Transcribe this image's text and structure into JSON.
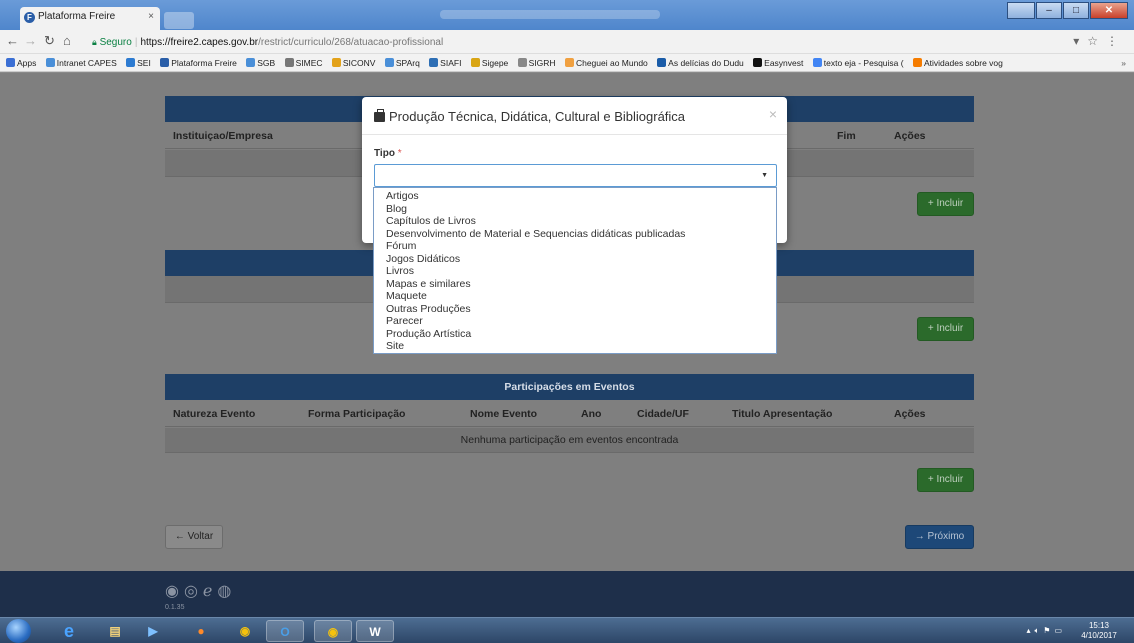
{
  "browser": {
    "tab_title": "Plataforma Freire",
    "tab_close": "×",
    "url_secure_label": "Seguro",
    "url_host": "https://freire2.capes.gov.br",
    "url_path": "/restrict/curriculo/268/atuacao-profissional",
    "bookmarks": [
      "Apps",
      "Intranet CAPES",
      "SEI",
      "Plataforma Freire",
      "SGB",
      "SIMEC",
      "SICONV",
      "SPArq",
      "SIAFI",
      "Sigepe",
      "SIGRH",
      "Cheguei ao Mundo",
      "As delícias do Dudu",
      "Easynvest",
      "texto eja - Pesquisa (",
      "Atividades sobre vog"
    ],
    "bookmarks_more": "»"
  },
  "page": {
    "section1": {
      "col_instituicao": "Instituiçao/Empresa",
      "col_fim": "Fim",
      "col_acoes": "Ações",
      "incluir": "Incluir"
    },
    "section2": {
      "incluir": "Incluir"
    },
    "eventos": {
      "title": "Participações em Eventos",
      "columns": [
        "Natureza Evento",
        "Forma Participação",
        "Nome Evento",
        "Ano",
        "Cidade/UF",
        "Titulo Apresentação",
        "Ações"
      ],
      "empty": "Nenhuma participação em eventos encontrada",
      "incluir": "Incluir"
    },
    "voltar": "Voltar",
    "proximo": "Próximo",
    "footer_version": "0.1.35"
  },
  "modal": {
    "title": "Produção Técnica, Didática, Cultural e Bibliográfica",
    "close": "×",
    "tipo_label": "Tipo",
    "required_mark": "*",
    "options": [
      "Artigos",
      "Blog",
      "Capítulos de Livros",
      "Desenvolvimento de Material e Sequencias didáticas publicadas",
      "Fórum",
      "Jogos Didáticos",
      "Livros",
      "Mapas e similares",
      "Maquete",
      "Outras Produções",
      "Parecer",
      "Produção Artística",
      "Site"
    ]
  },
  "taskbar": {
    "time": "15:13",
    "date": "4/10/2017"
  },
  "colors": {
    "panel_header": "#1e3f66",
    "btn_success": "#2b6a2b",
    "btn_primary": "#1d4878",
    "select_focus": "#5b9bd5"
  }
}
